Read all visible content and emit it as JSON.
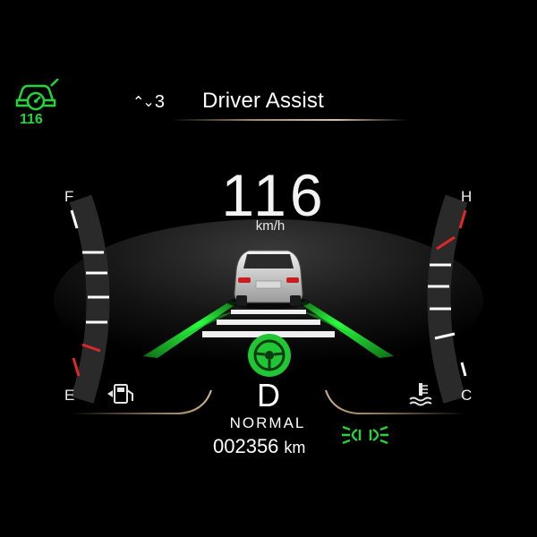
{
  "header": {
    "menu_index": "3",
    "title": "Driver Assist"
  },
  "cruise": {
    "icon": "cruise-control-icon",
    "set_speed": "116",
    "color": "#21d63a"
  },
  "speedometer": {
    "speed": "116",
    "unit": "km/h"
  },
  "fuel_gauge": {
    "full_label": "F",
    "empty_label": "E",
    "icon": "fuel-pump-icon"
  },
  "temp_gauge": {
    "hot_label": "H",
    "cold_label": "C",
    "icon": "coolant-temperature-icon"
  },
  "drive": {
    "gear": "D",
    "mode": "NORMAL",
    "odometer": "002356",
    "odometer_unit": "km",
    "assist_icon": "steering-wheel-icon",
    "headlight_icon": "parking-lights-icon"
  },
  "colors": {
    "accent_green": "#21d63a",
    "warning_red": "#e0282b",
    "trim_gold": "#c9b08a"
  }
}
